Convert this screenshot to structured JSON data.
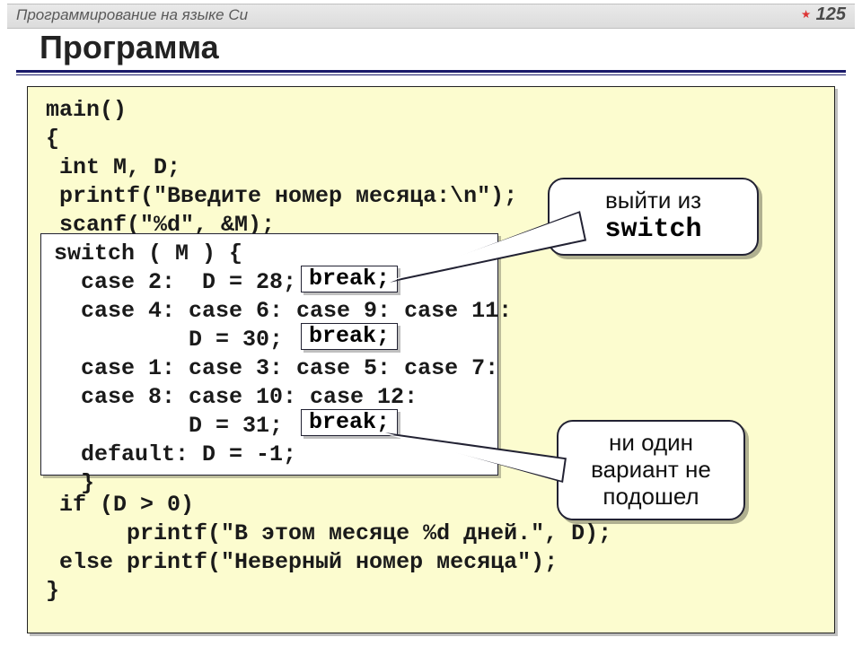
{
  "header": {
    "subject": "Программирование на языке Си",
    "page_number": "125"
  },
  "title": "Программа",
  "code_top": "main()\n{\n int M, D;\n printf(\"Введите номер месяца:\\n\");\n scanf(\"%d\", &M);",
  "switch_code": "switch ( M ) {\n  case 2:  D = 28;\n  case 4: case 6: case 9: case 11:\n          D = 30;\n  case 1: case 3: case 5: case 7:\n  case 8: case 10: case 12:\n          D = 31;\n  default: D = -1;\n  }",
  "break_label": "break;",
  "code_bottom": " if (D > 0)\n      printf(\"В этом месяце %d дней.\", D);\n else printf(\"Неверный номер месяца\");\n}",
  "callout1": {
    "line1": "выйти из",
    "line2": "switch"
  },
  "callout2": {
    "line1": "ни один",
    "line2": "вариант не",
    "line3": "подошел"
  }
}
